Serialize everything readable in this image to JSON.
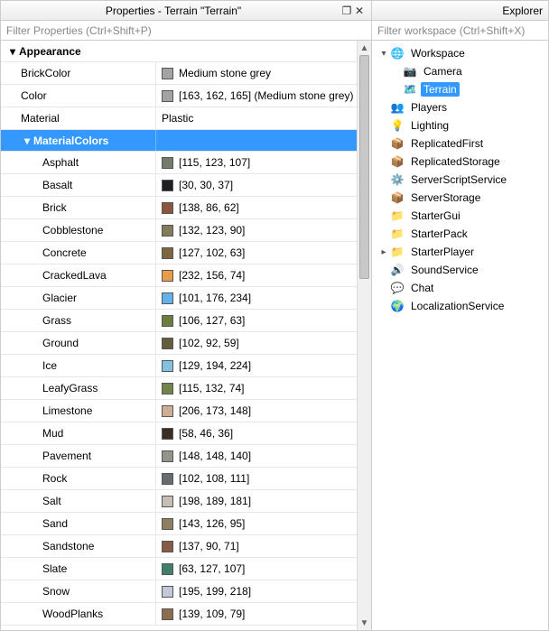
{
  "properties": {
    "title": "Properties - Terrain \"Terrain\"",
    "filter_placeholder": "Filter Properties (Ctrl+Shift+P)",
    "section": {
      "label": "Appearance",
      "props": [
        {
          "name": "BrickColor",
          "swatch": "#a3a2a5",
          "value": "Medium stone grey"
        },
        {
          "name": "Color",
          "swatch": "#a3a2a5",
          "value": "[163, 162, 165] (Medium stone grey)"
        },
        {
          "name": "Material",
          "swatch": null,
          "value": "Plastic"
        }
      ],
      "material_colors_label": "MaterialColors",
      "materials": [
        {
          "name": "Asphalt",
          "swatch": "#737b6b",
          "value": "[115, 123, 107]"
        },
        {
          "name": "Basalt",
          "swatch": "#1e1e25",
          "value": "[30, 30, 37]"
        },
        {
          "name": "Brick",
          "swatch": "#8a563e",
          "value": "[138, 86, 62]"
        },
        {
          "name": "Cobblestone",
          "swatch": "#847b5a",
          "value": "[132, 123, 90]"
        },
        {
          "name": "Concrete",
          "swatch": "#7f663f",
          "value": "[127, 102, 63]"
        },
        {
          "name": "CrackedLava",
          "swatch": "#e89c4a",
          "value": "[232, 156, 74]"
        },
        {
          "name": "Glacier",
          "swatch": "#65b0ea",
          "value": "[101, 176, 234]"
        },
        {
          "name": "Grass",
          "swatch": "#6a7f3f",
          "value": "[106, 127, 63]"
        },
        {
          "name": "Ground",
          "swatch": "#665c3b",
          "value": "[102, 92, 59]"
        },
        {
          "name": "Ice",
          "swatch": "#81c2e0",
          "value": "[129, 194, 224]"
        },
        {
          "name": "LeafyGrass",
          "swatch": "#73844a",
          "value": "[115, 132, 74]"
        },
        {
          "name": "Limestone",
          "swatch": "#cead94",
          "value": "[206, 173, 148]"
        },
        {
          "name": "Mud",
          "swatch": "#3a2e24",
          "value": "[58, 46, 36]"
        },
        {
          "name": "Pavement",
          "swatch": "#94948c",
          "value": "[148, 148, 140]"
        },
        {
          "name": "Rock",
          "swatch": "#666c6f",
          "value": "[102, 108, 111]"
        },
        {
          "name": "Salt",
          "swatch": "#c6bdb5",
          "value": "[198, 189, 181]"
        },
        {
          "name": "Sand",
          "swatch": "#8f7e5f",
          "value": "[143, 126, 95]"
        },
        {
          "name": "Sandstone",
          "swatch": "#895a47",
          "value": "[137, 90, 71]"
        },
        {
          "name": "Slate",
          "swatch": "#3f7f6b",
          "value": "[63, 127, 107]"
        },
        {
          "name": "Snow",
          "swatch": "#c3c7da",
          "value": "[195, 199, 218]"
        },
        {
          "name": "WoodPlanks",
          "swatch": "#8b6d4f",
          "value": "[139, 109, 79]"
        }
      ]
    }
  },
  "explorer": {
    "title": "Explorer",
    "filter_placeholder": "Filter workspace (Ctrl+Shift+X)",
    "tree": [
      {
        "depth": 0,
        "chev": "open",
        "icon": "🌐",
        "icon_name": "workspace-icon",
        "label": "Workspace",
        "selected": false
      },
      {
        "depth": 1,
        "chev": "none",
        "icon": "📷",
        "icon_name": "camera-icon",
        "label": "Camera",
        "selected": false
      },
      {
        "depth": 1,
        "chev": "none",
        "icon": "🗺️",
        "icon_name": "terrain-icon",
        "label": "Terrain",
        "selected": true
      },
      {
        "depth": 0,
        "chev": "none",
        "icon": "👥",
        "icon_name": "players-icon",
        "label": "Players",
        "selected": false
      },
      {
        "depth": 0,
        "chev": "none",
        "icon": "💡",
        "icon_name": "lighting-icon",
        "label": "Lighting",
        "selected": false
      },
      {
        "depth": 0,
        "chev": "none",
        "icon": "📦",
        "icon_name": "replicatedfirst-icon",
        "label": "ReplicatedFirst",
        "selected": false
      },
      {
        "depth": 0,
        "chev": "none",
        "icon": "📦",
        "icon_name": "replicatedstorage-icon",
        "label": "ReplicatedStorage",
        "selected": false
      },
      {
        "depth": 0,
        "chev": "none",
        "icon": "⚙️",
        "icon_name": "serverscriptservice-icon",
        "label": "ServerScriptService",
        "selected": false
      },
      {
        "depth": 0,
        "chev": "none",
        "icon": "📦",
        "icon_name": "serverstorage-icon",
        "label": "ServerStorage",
        "selected": false
      },
      {
        "depth": 0,
        "chev": "none",
        "icon": "📁",
        "icon_name": "startergui-icon",
        "label": "StarterGui",
        "selected": false
      },
      {
        "depth": 0,
        "chev": "none",
        "icon": "📁",
        "icon_name": "starterpack-icon",
        "label": "StarterPack",
        "selected": false
      },
      {
        "depth": 0,
        "chev": "closed",
        "icon": "📁",
        "icon_name": "starterplayer-icon",
        "label": "StarterPlayer",
        "selected": false
      },
      {
        "depth": 0,
        "chev": "none",
        "icon": "🔊",
        "icon_name": "soundservice-icon",
        "label": "SoundService",
        "selected": false
      },
      {
        "depth": 0,
        "chev": "none",
        "icon": "💬",
        "icon_name": "chat-icon",
        "label": "Chat",
        "selected": false
      },
      {
        "depth": 0,
        "chev": "none",
        "icon": "🌍",
        "icon_name": "localizationservice-icon",
        "label": "LocalizationService",
        "selected": false
      }
    ]
  }
}
